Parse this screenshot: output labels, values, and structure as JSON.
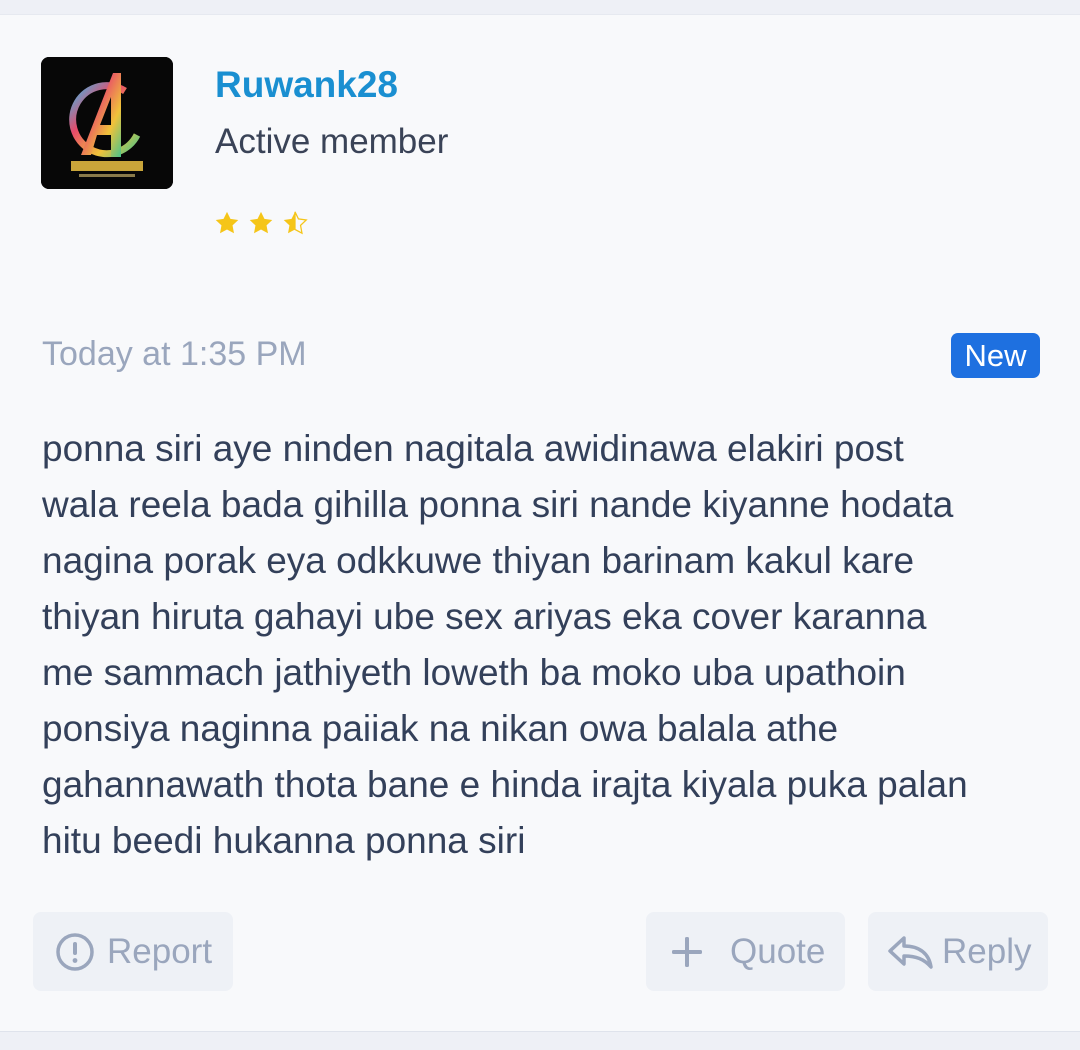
{
  "post": {
    "username": "Ruwank28",
    "user_title": "Active member",
    "rating_stars": 2.5,
    "timestamp": "Today at 1:35 PM",
    "badge": "New",
    "message_lines": [
      "ponna siri aye ninden nagitala awidinawa elakiri post",
      "wala reela bada gihilla ponna siri nande kiyanne hodata",
      "nagina porak eya odkkuwe thiyan barinam kakul kare",
      "thiyan hiruta gahayi ube sex ariyas eka cover karanna",
      "me sammach jathiyeth loweth ba moko uba upathoin",
      "ponsiya naginna paiiak na nikan owa balala athe",
      "gahannawath thota bane e hinda irajta kiyala puka palan",
      "hitu beedi hukanna ponna siri"
    ]
  },
  "avatar": {
    "icon": "avengers-logo-icon"
  },
  "actions": {
    "report_label": "Report",
    "quote_label": "Quote",
    "reply_label": "Reply"
  },
  "colors": {
    "username": "#1a8fd1",
    "badge_bg": "#1e70e0",
    "star": "#f5c518",
    "muted": "#9aa6bd",
    "text": "#33405a"
  }
}
